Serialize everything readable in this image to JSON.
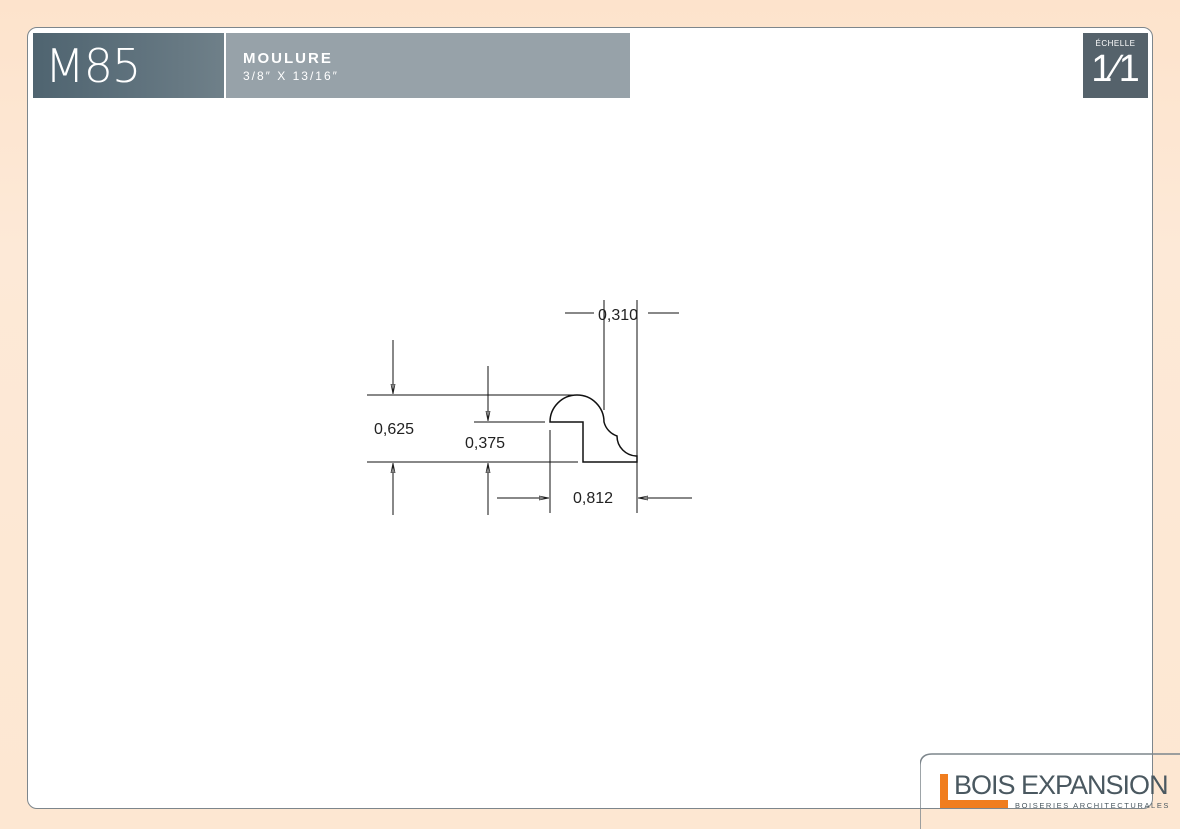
{
  "header": {
    "code": "M85",
    "title": "MOULURE",
    "subtitle": "3/8″ X 13/16″",
    "scale_label": "ÉCHELLE",
    "scale_value": "1⁄1"
  },
  "dimensions": {
    "overall_height": "0,625",
    "step_height": "0,375",
    "overall_width": "0,812",
    "top_width": "0,310"
  },
  "logo": {
    "name": "BOIS EXPANSION",
    "tagline": "BOISERIES ARCHITECTURALES",
    "accent_color": "#f07d1e"
  },
  "colors": {
    "header_dark": "#4f6470",
    "header_light": "#97a2a9",
    "scale_box": "#55626b",
    "border": "#7d868c",
    "background": "#fde7d2"
  }
}
